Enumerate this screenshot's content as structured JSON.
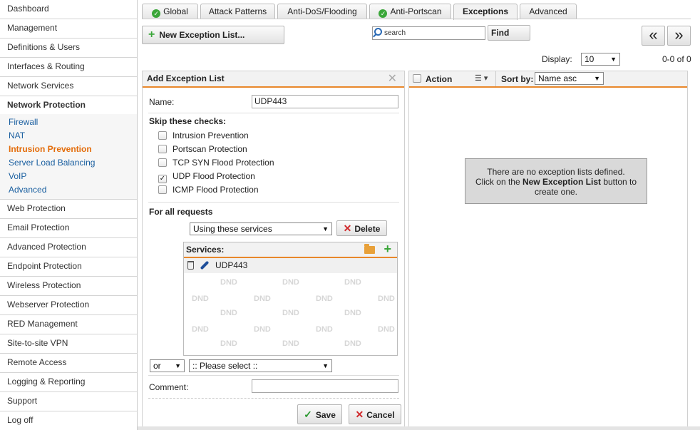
{
  "sidebar": {
    "items_top": [
      "Dashboard",
      "Management",
      "Definitions & Users",
      "Interfaces & Routing",
      "Network Services"
    ],
    "group": {
      "label": "Network Protection",
      "subitems": [
        "Firewall",
        "NAT",
        "Intrusion Prevention",
        "Server Load Balancing",
        "VoIP",
        "Advanced"
      ]
    },
    "items_bottom": [
      "Web Protection",
      "Email Protection",
      "Advanced Protection",
      "Endpoint Protection",
      "Wireless Protection",
      "Webserver Protection",
      "RED Management",
      "Site-to-site VPN",
      "Remote Access",
      "Logging & Reporting",
      "Support",
      "Log off"
    ]
  },
  "tabs": {
    "global": "Global",
    "attack_patterns": "Attack Patterns",
    "anti_dos": "Anti-DoS/Flooding",
    "anti_portscan": "Anti-Portscan",
    "exceptions": "Exceptions",
    "advanced": "Advanced"
  },
  "toolbar": {
    "new_list_label": "New Exception List...",
    "search_value": "search",
    "find_label": "Find",
    "prev_label": "«",
    "next_label": "»",
    "display_label": "Display:",
    "display_value": "10",
    "range_label": "0-0 of 0"
  },
  "form": {
    "title": "Add Exception List",
    "name_label": "Name:",
    "name_value": "UDP443",
    "skip_label": "Skip these checks:",
    "checks": [
      {
        "label": "Intrusion Prevention",
        "checked": false
      },
      {
        "label": "Portscan Protection",
        "checked": false
      },
      {
        "label": "TCP SYN Flood Protection",
        "checked": false
      },
      {
        "label": "UDP Flood Protection",
        "checked": true
      },
      {
        "label": "ICMP Flood Protection",
        "checked": false
      }
    ],
    "requests_label": "For all requests",
    "services_select": "Using these services",
    "delete_label": "Delete",
    "services_title": "Services:",
    "service_item": "UDP443",
    "dnd_text": "DND",
    "or_value": "or",
    "please_select": ":: Please select ::",
    "comment_label": "Comment:",
    "comment_value": "",
    "save_label": "Save",
    "cancel_label": "Cancel"
  },
  "list": {
    "action_label": "Action",
    "sortby_label": "Sort by:",
    "sort_value": "Name asc",
    "empty_line1": "There are no exception lists defined.",
    "empty_line2_pre": "Click on the ",
    "empty_line2_bold": "New Exception List",
    "empty_line2_post": " button to",
    "empty_line3": "create one."
  },
  "colors": {
    "accent": "#e8882b",
    "active_nav": "#e36c0a",
    "link": "#1a5fa0",
    "ok_green": "#3aa639",
    "delete_red": "#d0282b"
  }
}
